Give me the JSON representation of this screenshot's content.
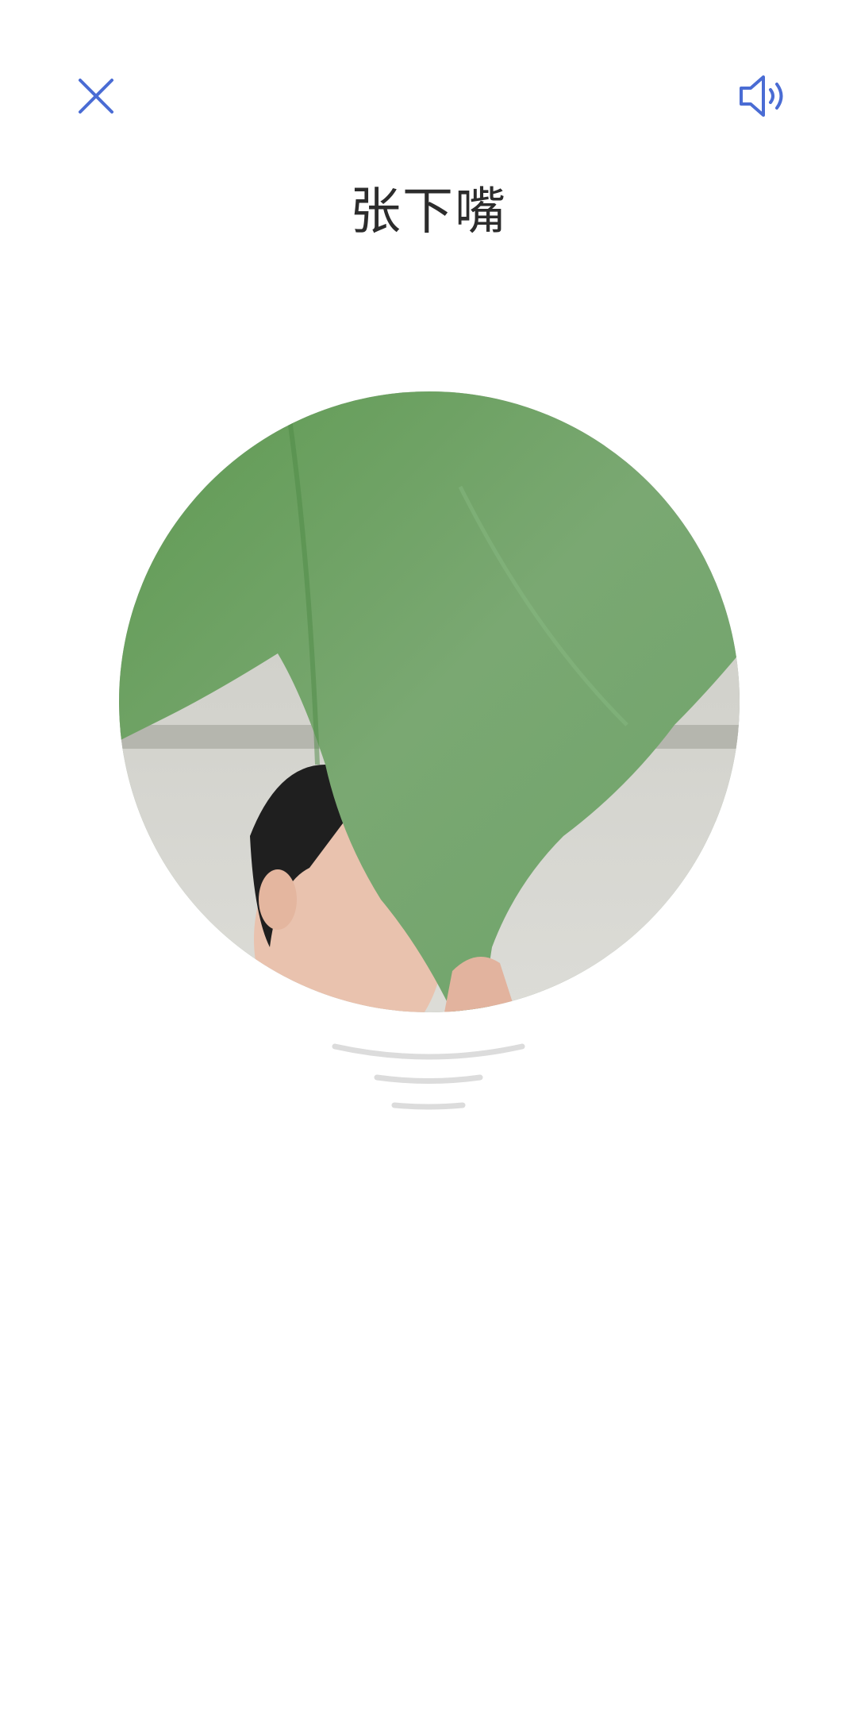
{
  "header": {
    "close_icon": "close-icon",
    "sound_icon": "speaker-icon",
    "accent_color": "#4a6cd4"
  },
  "prompt": {
    "text": "张下嘴"
  },
  "camera": {
    "content": "live-camera-preview",
    "shape": "circle"
  },
  "indicator": {
    "icon": "wave-lines-icon",
    "color": "#dcdcdc"
  }
}
